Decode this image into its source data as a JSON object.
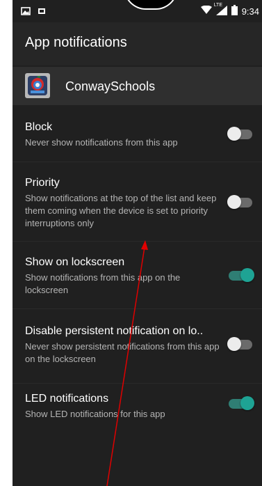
{
  "status_bar": {
    "time": "9:34",
    "network": "LTE",
    "left_icons": [
      "image-icon",
      "sim-icon"
    ],
    "right_icons": [
      "wifi-icon",
      "signal-icon",
      "battery-icon"
    ]
  },
  "header": {
    "title": "App notifications"
  },
  "app": {
    "name": "ConwaySchools",
    "icon": "app-logo-icon"
  },
  "settings": [
    {
      "title": "Block",
      "subtitle": "Never show notifications from this app",
      "enabled": false
    },
    {
      "title": "Priority",
      "subtitle": "Show notifications at the top of the list and keep them coming when the device is set to priority interruptions only",
      "enabled": false
    },
    {
      "title": "Show on lockscreen",
      "subtitle": "Show notifications from this app on the lockscreen",
      "enabled": true
    },
    {
      "title": "Disable persistent notification on lo..",
      "subtitle": "Never show persistent notifications from this app on the lockscreen",
      "enabled": false
    },
    {
      "title": "LED notifications",
      "subtitle": "Show LED notifications for this app",
      "enabled": true
    }
  ],
  "colors": {
    "background": "#202020",
    "accent": "#1ea394",
    "annotation": "#e00000"
  }
}
